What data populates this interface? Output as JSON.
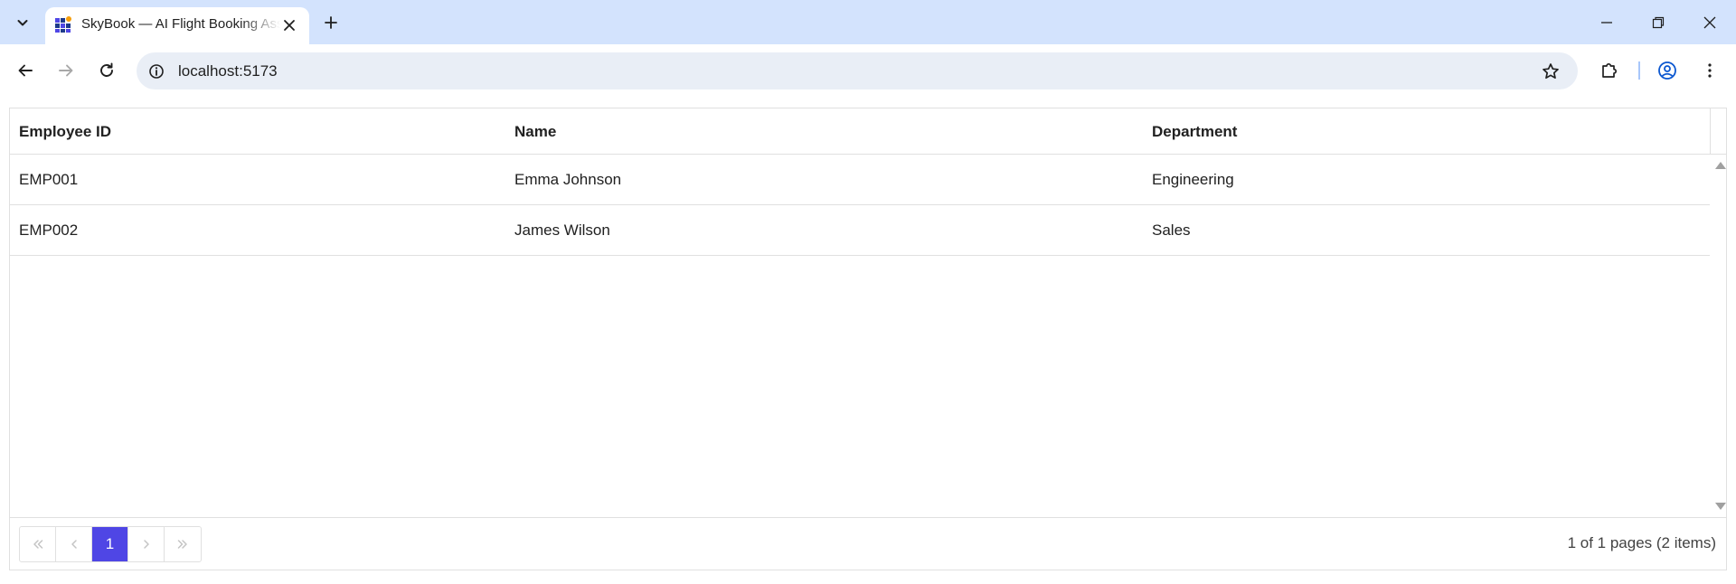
{
  "browser": {
    "tab_title": "SkyBook — AI Flight Booking Assistant",
    "url": "localhost:5173"
  },
  "grid": {
    "columns": [
      "Employee ID",
      "Name",
      "Department"
    ],
    "rows": [
      [
        "EMP001",
        "Emma Johnson",
        "Engineering"
      ],
      [
        "EMP002",
        "James Wilson",
        "Sales"
      ]
    ]
  },
  "pager": {
    "first_icon": "double-chevron-left-icon",
    "prev_icon": "chevron-left-icon",
    "current_page": "1",
    "next_icon": "chevron-right-icon",
    "last_icon": "double-chevron-right-icon",
    "info": "1 of 1 pages (2 items)"
  },
  "colors": {
    "accent": "#4f46e5",
    "tabbar": "#d3e3fd",
    "omnibox": "#e9eef6"
  }
}
